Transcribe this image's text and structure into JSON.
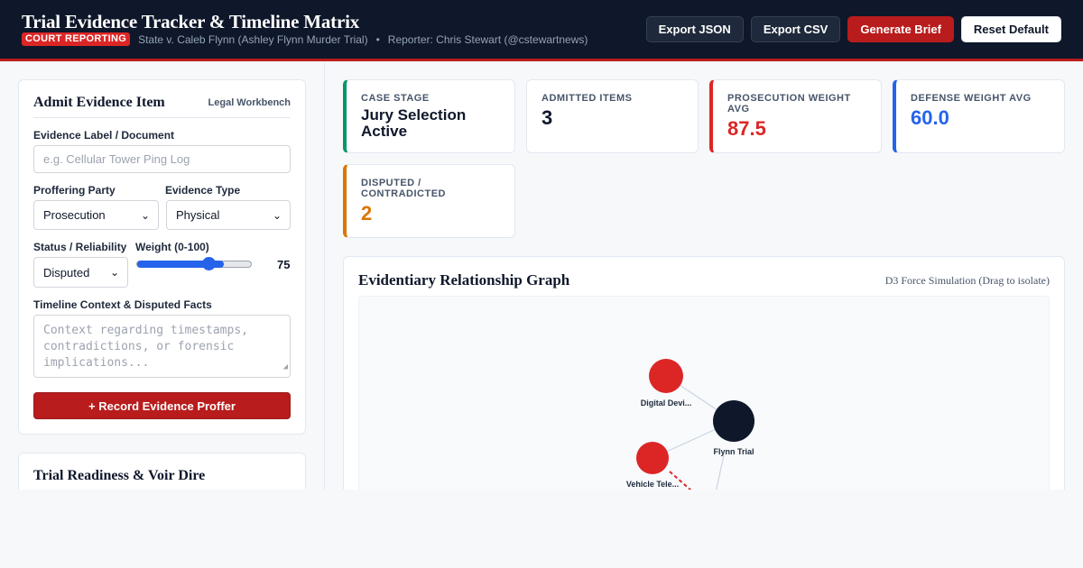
{
  "header": {
    "title": "Trial Evidence Tracker & Timeline Matrix",
    "badge": "COURT REPORTING",
    "case": "State v. Caleb Flynn (Ashley Flynn Murder Trial)",
    "separator": "•",
    "reporter": "Reporter: Chris Stewart (@cstewartnews)",
    "buttons": {
      "export_json": "Export JSON",
      "export_csv": "Export CSV",
      "generate_brief": "Generate Brief",
      "reset_default": "Reset Default"
    }
  },
  "form": {
    "title": "Admit Evidence Item",
    "tag": "Legal Workbench",
    "label_field": {
      "label": "Evidence Label / Document",
      "placeholder": "e.g. Cellular Tower Ping Log"
    },
    "party": {
      "label": "Proffering Party",
      "value": "Prosecution"
    },
    "type": {
      "label": "Evidence Type",
      "value": "Physical"
    },
    "status": {
      "label": "Status / Reliability",
      "value": "Disputed"
    },
    "weight": {
      "label": "Weight (0-100)",
      "value": 75,
      "max": 100,
      "display": "75"
    },
    "context": {
      "label": "Timeline Context & Disputed Facts",
      "placeholder": "Context regarding timestamps, contradictions, or forensic implications..."
    },
    "submit": "+ Record Evidence Proffer"
  },
  "readiness": {
    "title": "Trial Readiness & Voir Dire"
  },
  "stats": {
    "stage": {
      "label": "CASE STAGE",
      "value": "Jury Selection Active",
      "accent": "#059669"
    },
    "admitted": {
      "label": "ADMITTED ITEMS",
      "value": "3"
    },
    "prosecution": {
      "label": "PROSECUTION WEIGHT AVG",
      "value": "87.5",
      "accent": "#dc2626"
    },
    "defense": {
      "label": "DEFENSE WEIGHT AVG",
      "value": "60.0",
      "accent": "#2563eb"
    },
    "disputed": {
      "label": "DISPUTED / CONTRADICTED",
      "value": "2",
      "accent": "#d97706"
    }
  },
  "graph": {
    "title": "Evidentiary Relationship Graph",
    "note": "D3 Force Simulation (Drag to isolate)",
    "nodes": [
      {
        "id": "digital",
        "label": "Digital Devi...",
        "color": "#dc2626"
      },
      {
        "id": "flynn",
        "label": "Flynn Trial",
        "color": "#0f172a"
      },
      {
        "id": "vehicle",
        "label": "Vehicle Tele...",
        "color": "#dc2626"
      }
    ],
    "links": [
      {
        "source": "digital",
        "target": "flynn",
        "style": "solid"
      },
      {
        "source": "vehicle",
        "target": "flynn",
        "style": "solid"
      },
      {
        "source": "flynn",
        "target": "offscreen",
        "style": "solid"
      },
      {
        "source": "vehicle",
        "target": "offscreen",
        "style": "dashed",
        "color": "#dc2626"
      }
    ]
  }
}
